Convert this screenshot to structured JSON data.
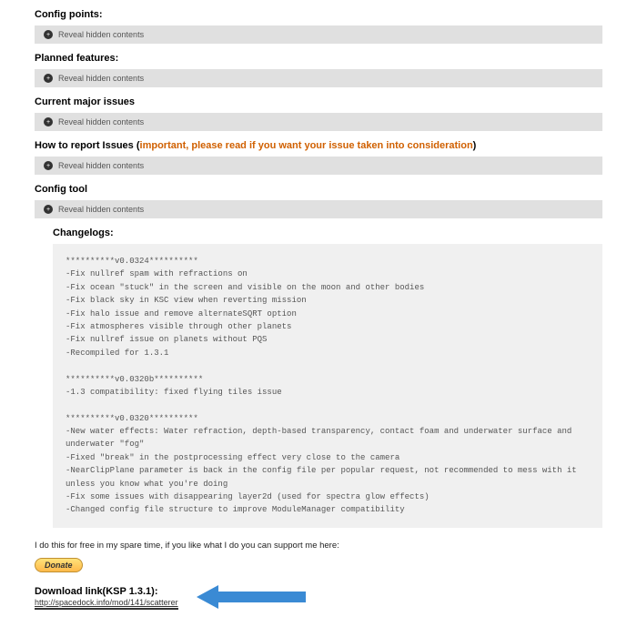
{
  "sections": {
    "config_points": {
      "title": "Config points",
      "reveal": "Reveal hidden contents"
    },
    "planned": {
      "title": "Planned features",
      "reveal": "Reveal hidden contents"
    },
    "issues": {
      "title": "Current major issues",
      "reveal": "Reveal hidden contents"
    },
    "report": {
      "title_prefix": "How to report Issues (",
      "title_orange": "important, please read if you want your issue taken into consideration",
      "title_suffix": ")",
      "reveal": "Reveal hidden contents"
    },
    "config_tool": {
      "title": "Config tool",
      "reveal": "Reveal hidden contents"
    },
    "changelogs": {
      "title": "Changelogs",
      "colon": ":"
    }
  },
  "changelog_text": "**********v0.0324**********\n-Fix nullref spam with refractions on\n-Fix ocean \"stuck\" in the screen and visible on the moon and other bodies\n-Fix black sky in KSC view when reverting mission\n-Fix halo issue and remove alternateSQRT option\n-Fix atmospheres visible through other planets\n-Fix nullref issue on planets without PQS\n-Recompiled for 1.3.1\n\n**********v0.0320b**********\n-1.3 compatibility: fixed flying tiles issue\n\n**********v0.0320**********\n-New water effects: Water refraction, depth-based transparency, contact foam and underwater surface and underwater \"fog\"\n-Fixed \"break\" in the postprocessing effect very close to the camera\n-NearClipPlane parameter is back in the config file per popular request, not recommended to mess with it unless you know what you're doing\n-Fix some issues with disappearing layer2d (used for spectra glow effects)\n-Changed config file structure to improve ModuleManager compatibility",
  "support_text": "I do this for free in my spare time, if you like what I do you can support me here:",
  "donate_label": "Donate",
  "download": {
    "title": "Download link(KSP 1.3.1):",
    "url_text": "http://spacedock.info/mod/141/scatterer"
  }
}
